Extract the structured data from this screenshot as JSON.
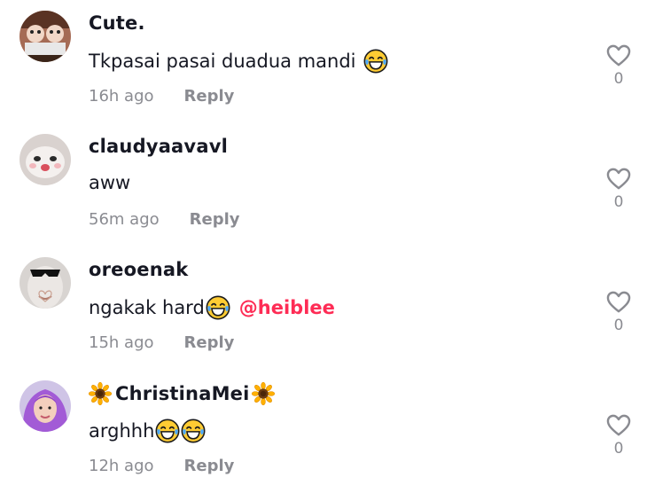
{
  "comments": [
    {
      "username": "Cute.",
      "text": "Tkpasai pasai duadua mandi",
      "emoji": [
        "tears-of-joy-emoji"
      ],
      "time": "16h ago",
      "reply_label": "Reply",
      "likes": "0"
    },
    {
      "username": "claudyaavavl",
      "text": "aww",
      "emoji": [],
      "time": "56m ago",
      "reply_label": "Reply",
      "likes": "0"
    },
    {
      "username": "oreoenak",
      "text": "ngakak hard",
      "emoji": [
        "tears-of-joy-emoji"
      ],
      "mention": "@heiblee",
      "time": "15h ago",
      "reply_label": "Reply",
      "likes": "0"
    },
    {
      "username": "ChristinaMei",
      "username_decoration": "sunflower-emoji",
      "text": "arghhh",
      "emoji": [
        "tears-of-joy-emoji",
        "tears-of-joy-emoji"
      ],
      "time": "12h ago",
      "reply_label": "Reply",
      "likes": "0"
    }
  ],
  "icons": {
    "like": "heart-outline-icon"
  },
  "colors": {
    "text": "#161823",
    "muted": "#8a8b91",
    "mention": "#fe2c55"
  }
}
